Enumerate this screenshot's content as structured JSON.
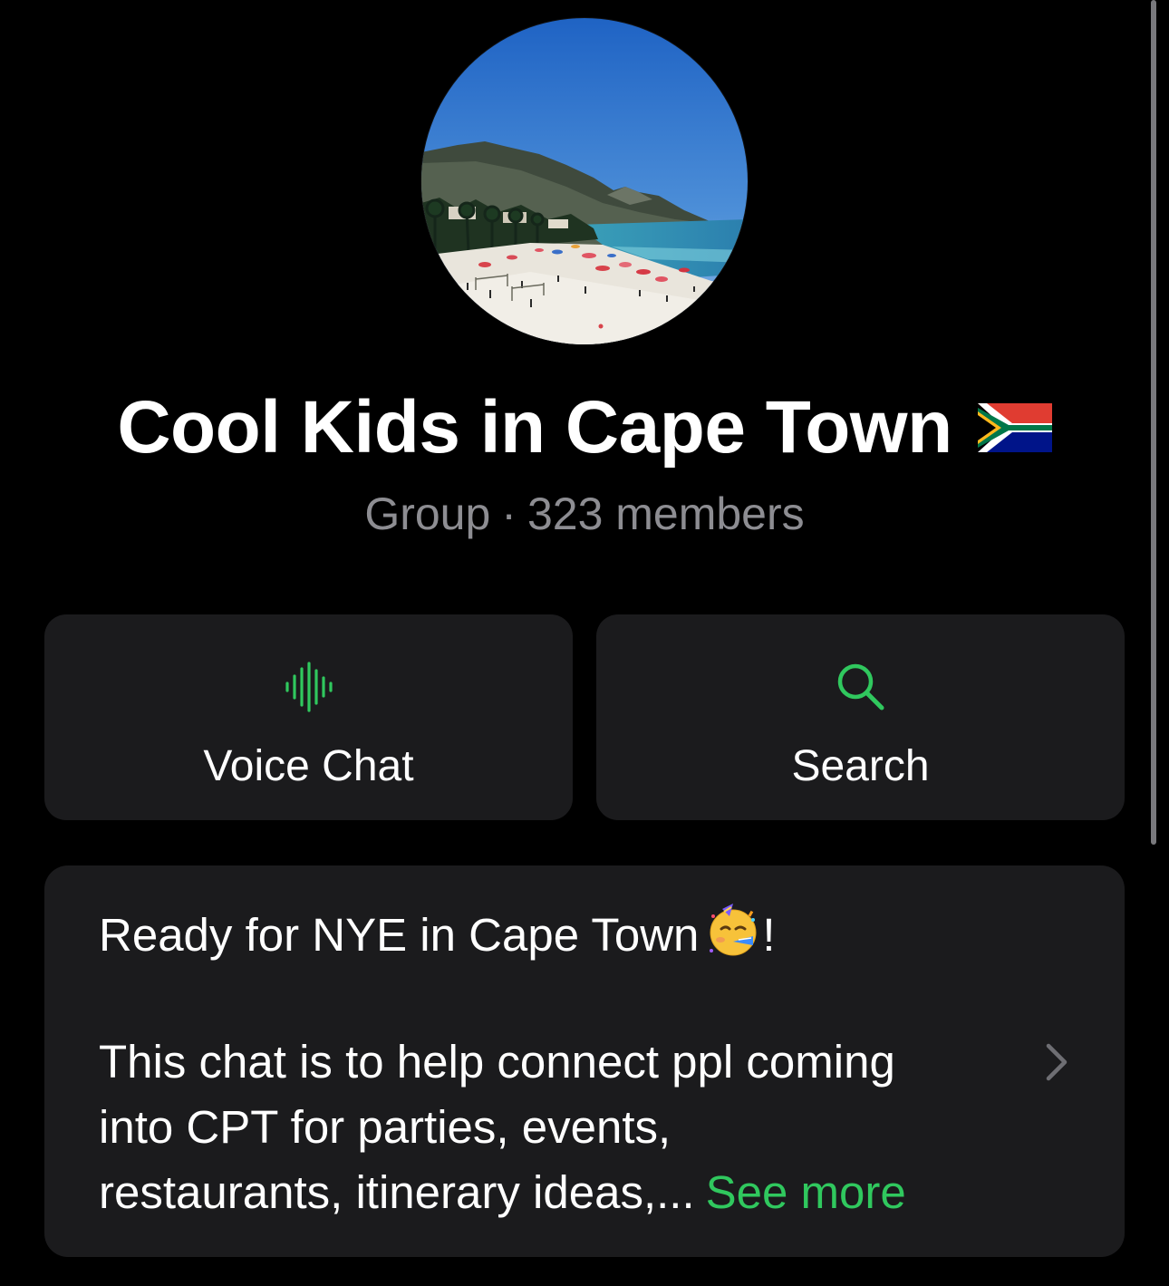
{
  "group": {
    "name": "Cool Kids in Cape Town",
    "flag_icon": "south-africa-flag-icon",
    "type": "Group",
    "separator": "·",
    "members": "323 members"
  },
  "actions": {
    "voice_chat": {
      "label": "Voice Chat",
      "icon": "waveform-icon"
    },
    "search": {
      "label": "Search",
      "icon": "search-icon"
    }
  },
  "description": {
    "line1": "Ready for NYE in Cape Town",
    "line1_suffix": "!",
    "line1_emoji": "partying-face-emoji",
    "line2": "This chat is to help connect ppl coming",
    "line3": "into CPT for parties, events,",
    "line4": "restaurants, itinerary ideas,...",
    "see_more": "See more"
  },
  "colors": {
    "accent": "#30c85e",
    "background": "#000000",
    "card": "#1b1b1d",
    "secondary_text": "#8d8d92"
  }
}
